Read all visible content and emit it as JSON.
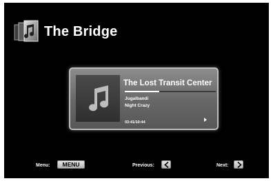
{
  "app": {
    "title": "The Bridge",
    "logo_icon": "music-library-icon"
  },
  "now_playing": {
    "track_title": "The Lost Transit Center",
    "artist": "Jugalbandi",
    "album": "Night Crazy",
    "time": "03:41/10:44",
    "progress": 0.38,
    "status_icon": "play-arrow-icon",
    "art_icon": "music-note-icon"
  },
  "footer": {
    "menu_hint": "Menu:",
    "menu_key": "MENU",
    "previous_hint": "Previous:",
    "previous_icon": "chevron-left-icon",
    "next_hint": "Next:",
    "next_icon": "chevron-right-icon"
  },
  "colors": {
    "background": "#000000",
    "card": "#6e6e6e",
    "text": "#ffffff"
  }
}
